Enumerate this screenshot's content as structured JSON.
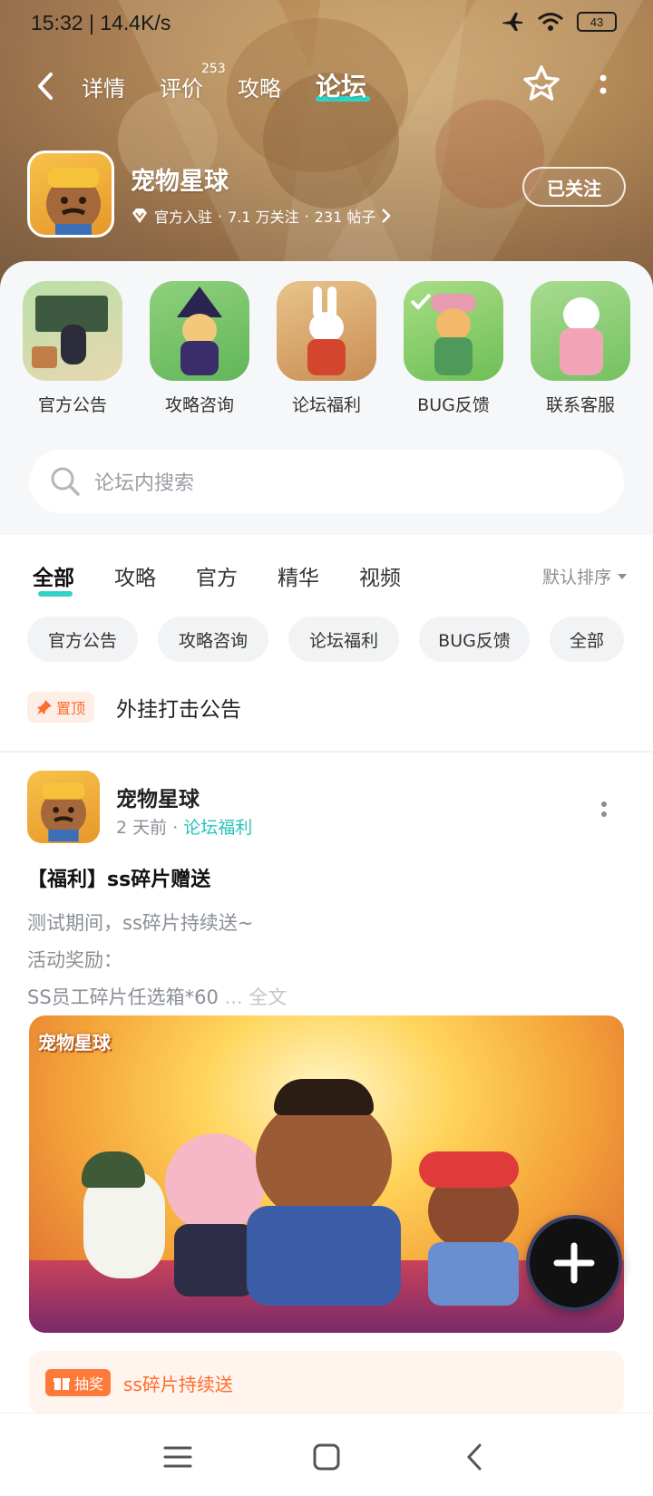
{
  "status_bar": {
    "time": "15:32",
    "speed": "14.4K/s",
    "battery": "43"
  },
  "nav": {
    "tabs": [
      {
        "label": "详情"
      },
      {
        "label": "评价",
        "badge": "253"
      },
      {
        "label": "攻略"
      },
      {
        "label": "论坛",
        "active": true
      }
    ]
  },
  "app": {
    "name": "宠物星球",
    "official": "官方入驻",
    "followers": "7.1 万关注",
    "posts": "231 帖子",
    "follow_label": "已关注"
  },
  "shortcuts": [
    {
      "label": "官方公告"
    },
    {
      "label": "攻略咨询"
    },
    {
      "label": "论坛福利"
    },
    {
      "label": "BUG反馈"
    },
    {
      "label": "联系客服"
    }
  ],
  "search": {
    "placeholder": "论坛内搜索"
  },
  "filter_tabs": [
    "全部",
    "攻略",
    "官方",
    "精华",
    "视频"
  ],
  "sort_label": "默认排序",
  "chips": [
    "官方公告",
    "攻略咨询",
    "论坛福利",
    "BUG反馈",
    "全部"
  ],
  "pinned": {
    "badge": "置顶",
    "title": "外挂打击公告"
  },
  "post": {
    "author": "宠物星球",
    "time": "2 天前",
    "category": "论坛福利",
    "title": "【福利】ss碎片赠送",
    "lines": [
      "测试期间，ss碎片持续送~",
      "活动奖励："
    ],
    "last_line": "SS员工碎片任选箱*60",
    "more": "... 全文",
    "image_logo_text": "宠物星球",
    "lottery_badge": "抽奖",
    "lottery_title": "ss碎片持续送"
  },
  "colors": {
    "accent": "#2fd4c7",
    "orange": "#ff6b2c"
  }
}
